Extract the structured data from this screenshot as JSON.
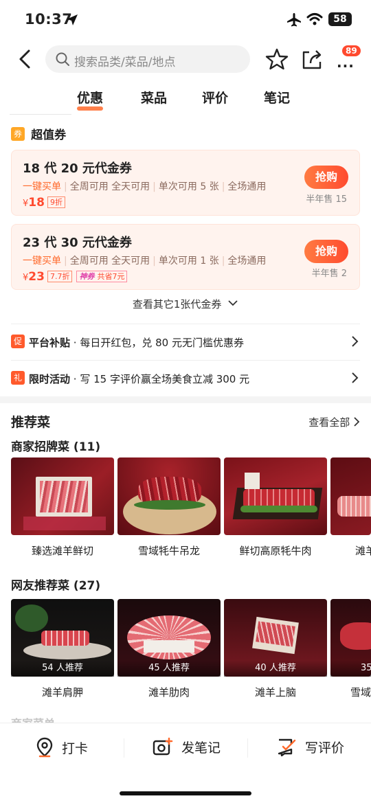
{
  "status": {
    "time": "10:37",
    "battery": "58"
  },
  "search": {
    "placeholder": "搜索品类/菜品/地点"
  },
  "more": {
    "badge": "89"
  },
  "tabs": [
    {
      "label": "优惠",
      "active": true
    },
    {
      "label": "菜品",
      "active": false
    },
    {
      "label": "评价",
      "active": false
    },
    {
      "label": "笔记",
      "active": false
    }
  ],
  "coupons": {
    "icon_text": "券",
    "title": "超值券",
    "items": [
      {
        "name": "18 代 20 元代金券",
        "tag1": "一键买单",
        "tag2": "全周可用 全天可用",
        "tag3": "单次可用 5 张",
        "tag4": "全场通用",
        "currency": "¥",
        "price": "18",
        "discount": "9折",
        "button": "抢购",
        "sold": "半年售 15"
      },
      {
        "name": "23 代 30 元代金券",
        "tag1": "一键买单",
        "tag2": "全周可用 全天可用",
        "tag3": "单次可用 1 张",
        "tag4": "全场通用",
        "currency": "¥",
        "price": "23",
        "discount": "7.7折",
        "shen_label": "神券",
        "shen_save": "共省7元",
        "button": "抢购",
        "sold": "半年售 2"
      }
    ],
    "more_label": "查看其它1张代金券"
  },
  "promos": [
    {
      "tag": "促",
      "bold": "平台补贴",
      "text": " · 每日开红包，兑 80 元无门槛优惠券",
      "color": "#ff5a2c"
    },
    {
      "tag": "礼",
      "bold": "限时活动",
      "text": " · 写 15 字评价赢全场美食立减 300 元",
      "color": "#ff5a2c"
    }
  ],
  "recommend": {
    "title": "推荐菜",
    "view_all": "查看全部",
    "signature": {
      "title": "商家招牌菜 (11)",
      "items": [
        "臻选滩羊鲜切",
        "雪域牦牛吊龙",
        "鲜切高原牦牛肉",
        "滩羊"
      ]
    },
    "popular": {
      "title": "网友推荐菜 (27)",
      "items": [
        {
          "name": "滩羊肩胛",
          "count": "54 人推荐"
        },
        {
          "name": "滩羊肋肉",
          "count": "45 人推荐"
        },
        {
          "name": "滩羊上脑",
          "count": "40 人推荐"
        },
        {
          "name": "雪域",
          "count": "35"
        }
      ]
    },
    "peek": "商家菜单"
  },
  "bottom": {
    "checkin": "打卡",
    "note": "发笔记",
    "review": "写评价"
  },
  "colors": {
    "accent": "#ff5a2c",
    "price": "#ff4a2f"
  }
}
